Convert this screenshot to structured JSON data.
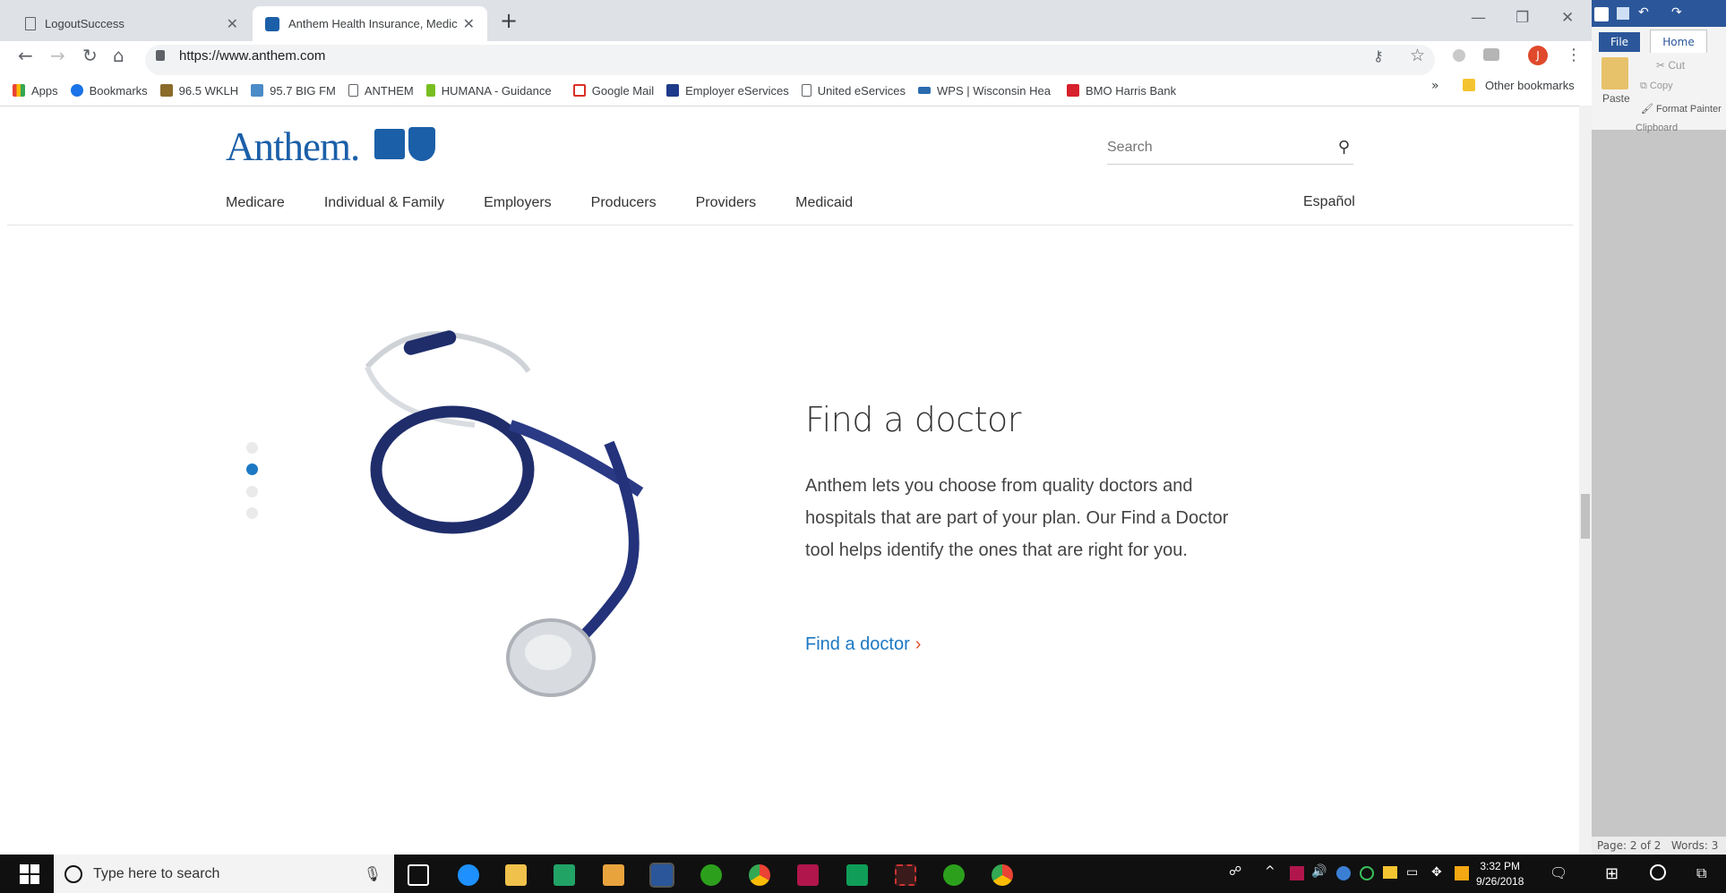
{
  "browser": {
    "tabs": [
      {
        "title": "LogoutSuccess",
        "active": false
      },
      {
        "title": "Anthem Health Insurance, Medic",
        "active": true
      }
    ],
    "url": "https://www.anthem.com",
    "bookmarks": [
      {
        "label": "Apps",
        "icon": "apps-icon"
      },
      {
        "label": "Bookmarks",
        "icon": "star-icon"
      },
      {
        "label": "96.5 WKLH",
        "icon": "radio-icon"
      },
      {
        "label": "95.7 BIG FM",
        "icon": "radio-icon"
      },
      {
        "label": "ANTHEM",
        "icon": "page-icon"
      },
      {
        "label": "HUMANA - Guidance",
        "icon": "humana-icon"
      },
      {
        "label": "Google Mail",
        "icon": "gmail-icon"
      },
      {
        "label": "Employer eServices",
        "icon": "ees-icon"
      },
      {
        "label": "United eServices",
        "icon": "page-icon"
      },
      {
        "label": "WPS | Wisconsin Hea",
        "icon": "wps-icon"
      },
      {
        "label": "BMO Harris Bank",
        "icon": "bmo-icon"
      }
    ],
    "other_bookmarks": "Other bookmarks",
    "profile_initial": "J"
  },
  "site": {
    "logo_text": "Anthem.",
    "search_placeholder": "Search",
    "nav": [
      "Medicare",
      "Individual & Family",
      "Employers",
      "Producers",
      "Providers",
      "Medicaid"
    ],
    "language": "Español",
    "hero": {
      "title": "Find a doctor",
      "body": "Anthem lets you choose from quality doctors and hospitals that are part of your plan. Our Find a Doctor tool helps identify the ones that are right for you.",
      "cta": "Find a doctor",
      "carousel_active_index": 1,
      "carousel_count": 4
    }
  },
  "word": {
    "file": "File",
    "home": "Home",
    "cut": "Cut",
    "copy": "Copy",
    "paste": "Paste",
    "format_painter": "Format Painter",
    "clipboard": "Clipboard",
    "page_status": "Page: 2 of 2",
    "words_status": "Words: 3"
  },
  "taskbar": {
    "search_placeholder": "Type here to search",
    "time": "3:32 PM",
    "date": "9/26/2018"
  },
  "colors": {
    "brand": "#1b5fa8",
    "link": "#1c78c3",
    "accent": "#e0532b"
  }
}
